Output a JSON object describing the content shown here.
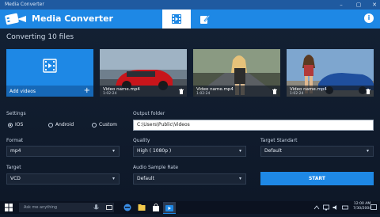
{
  "window": {
    "title": "Media Converter"
  },
  "app": {
    "title": "Media Converter",
    "tabs": [
      {
        "icon": "film-convert-icon",
        "active": true
      },
      {
        "icon": "edit-tools-icon",
        "active": false
      }
    ],
    "info_icon": "info-icon"
  },
  "colors": {
    "accent": "#1e88e5",
    "background": "#0f1a2b",
    "titlebar": "#1f5aa0"
  },
  "main": {
    "heading": "Converting 10 files",
    "add_videos": {
      "label": "Add videos",
      "plus": "+"
    },
    "videos": [
      {
        "name": "Video name.mp4",
        "duration": "1:02:24",
        "thumb": "red-car"
      },
      {
        "name": "Video name.mp4",
        "duration": "1:02:24",
        "thumb": "woman-road"
      },
      {
        "name": "Video name.mp4",
        "duration": "1:02:24",
        "thumb": "woman-car"
      }
    ]
  },
  "settings": {
    "label": "Settings",
    "options": [
      {
        "label": "IOS",
        "selected": true
      },
      {
        "label": "Android",
        "selected": false
      },
      {
        "label": "Custom",
        "selected": false
      }
    ]
  },
  "output_folder": {
    "label": "Output folder",
    "value": "C:\\Users\\Public\\Videos"
  },
  "format": {
    "label": "Format",
    "value": "mp4"
  },
  "quality": {
    "label": "Quality",
    "value": "High ( 1080p )"
  },
  "target_standart": {
    "label": "Target Standart",
    "value": "Default"
  },
  "target": {
    "label": "Target",
    "value": "VCD"
  },
  "audio_sample_rate": {
    "label": "Audio Sample Rate",
    "value": "Default"
  },
  "start_button": "START",
  "taskbar": {
    "search_placeholder": "Ask me anything",
    "time": "12:00 AM",
    "date": "7/30/2004"
  }
}
